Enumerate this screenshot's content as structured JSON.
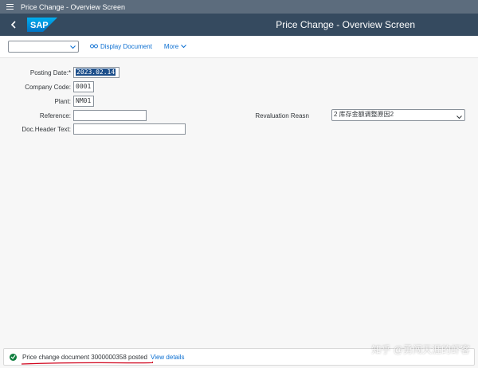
{
  "window": {
    "title": "Price Change - Overview Screen"
  },
  "shell": {
    "title": "Price Change - Overview Screen",
    "logo": "SAP"
  },
  "toolbar": {
    "variant_select_value": "",
    "display_document_label": "Display Document",
    "more_label": "More"
  },
  "form": {
    "posting_date": {
      "label": "Posting Date:*",
      "value": "2023.02.14"
    },
    "company_code": {
      "label": "Company Code:",
      "value": "0001"
    },
    "plant": {
      "label": "Plant:",
      "value": "NM01"
    },
    "reference": {
      "label": "Reference:",
      "value": ""
    },
    "doc_header_text": {
      "label": "Doc.Header Text:",
      "value": ""
    },
    "revaluation_reason": {
      "label": "Revaluation Reasn",
      "value": "2 库存金额调整原因2"
    }
  },
  "status": {
    "message": "Price change document 3000000358 posted",
    "link": "View details",
    "type": "success"
  },
  "watermark": "知乎 @勇闯天涯的虾客",
  "colors": {
    "shell_bg": "#354a5f",
    "title_bg": "#5c6c7d",
    "link": "#0a6ed1",
    "success": "#107e3e",
    "annotation": "#d0021b"
  }
}
